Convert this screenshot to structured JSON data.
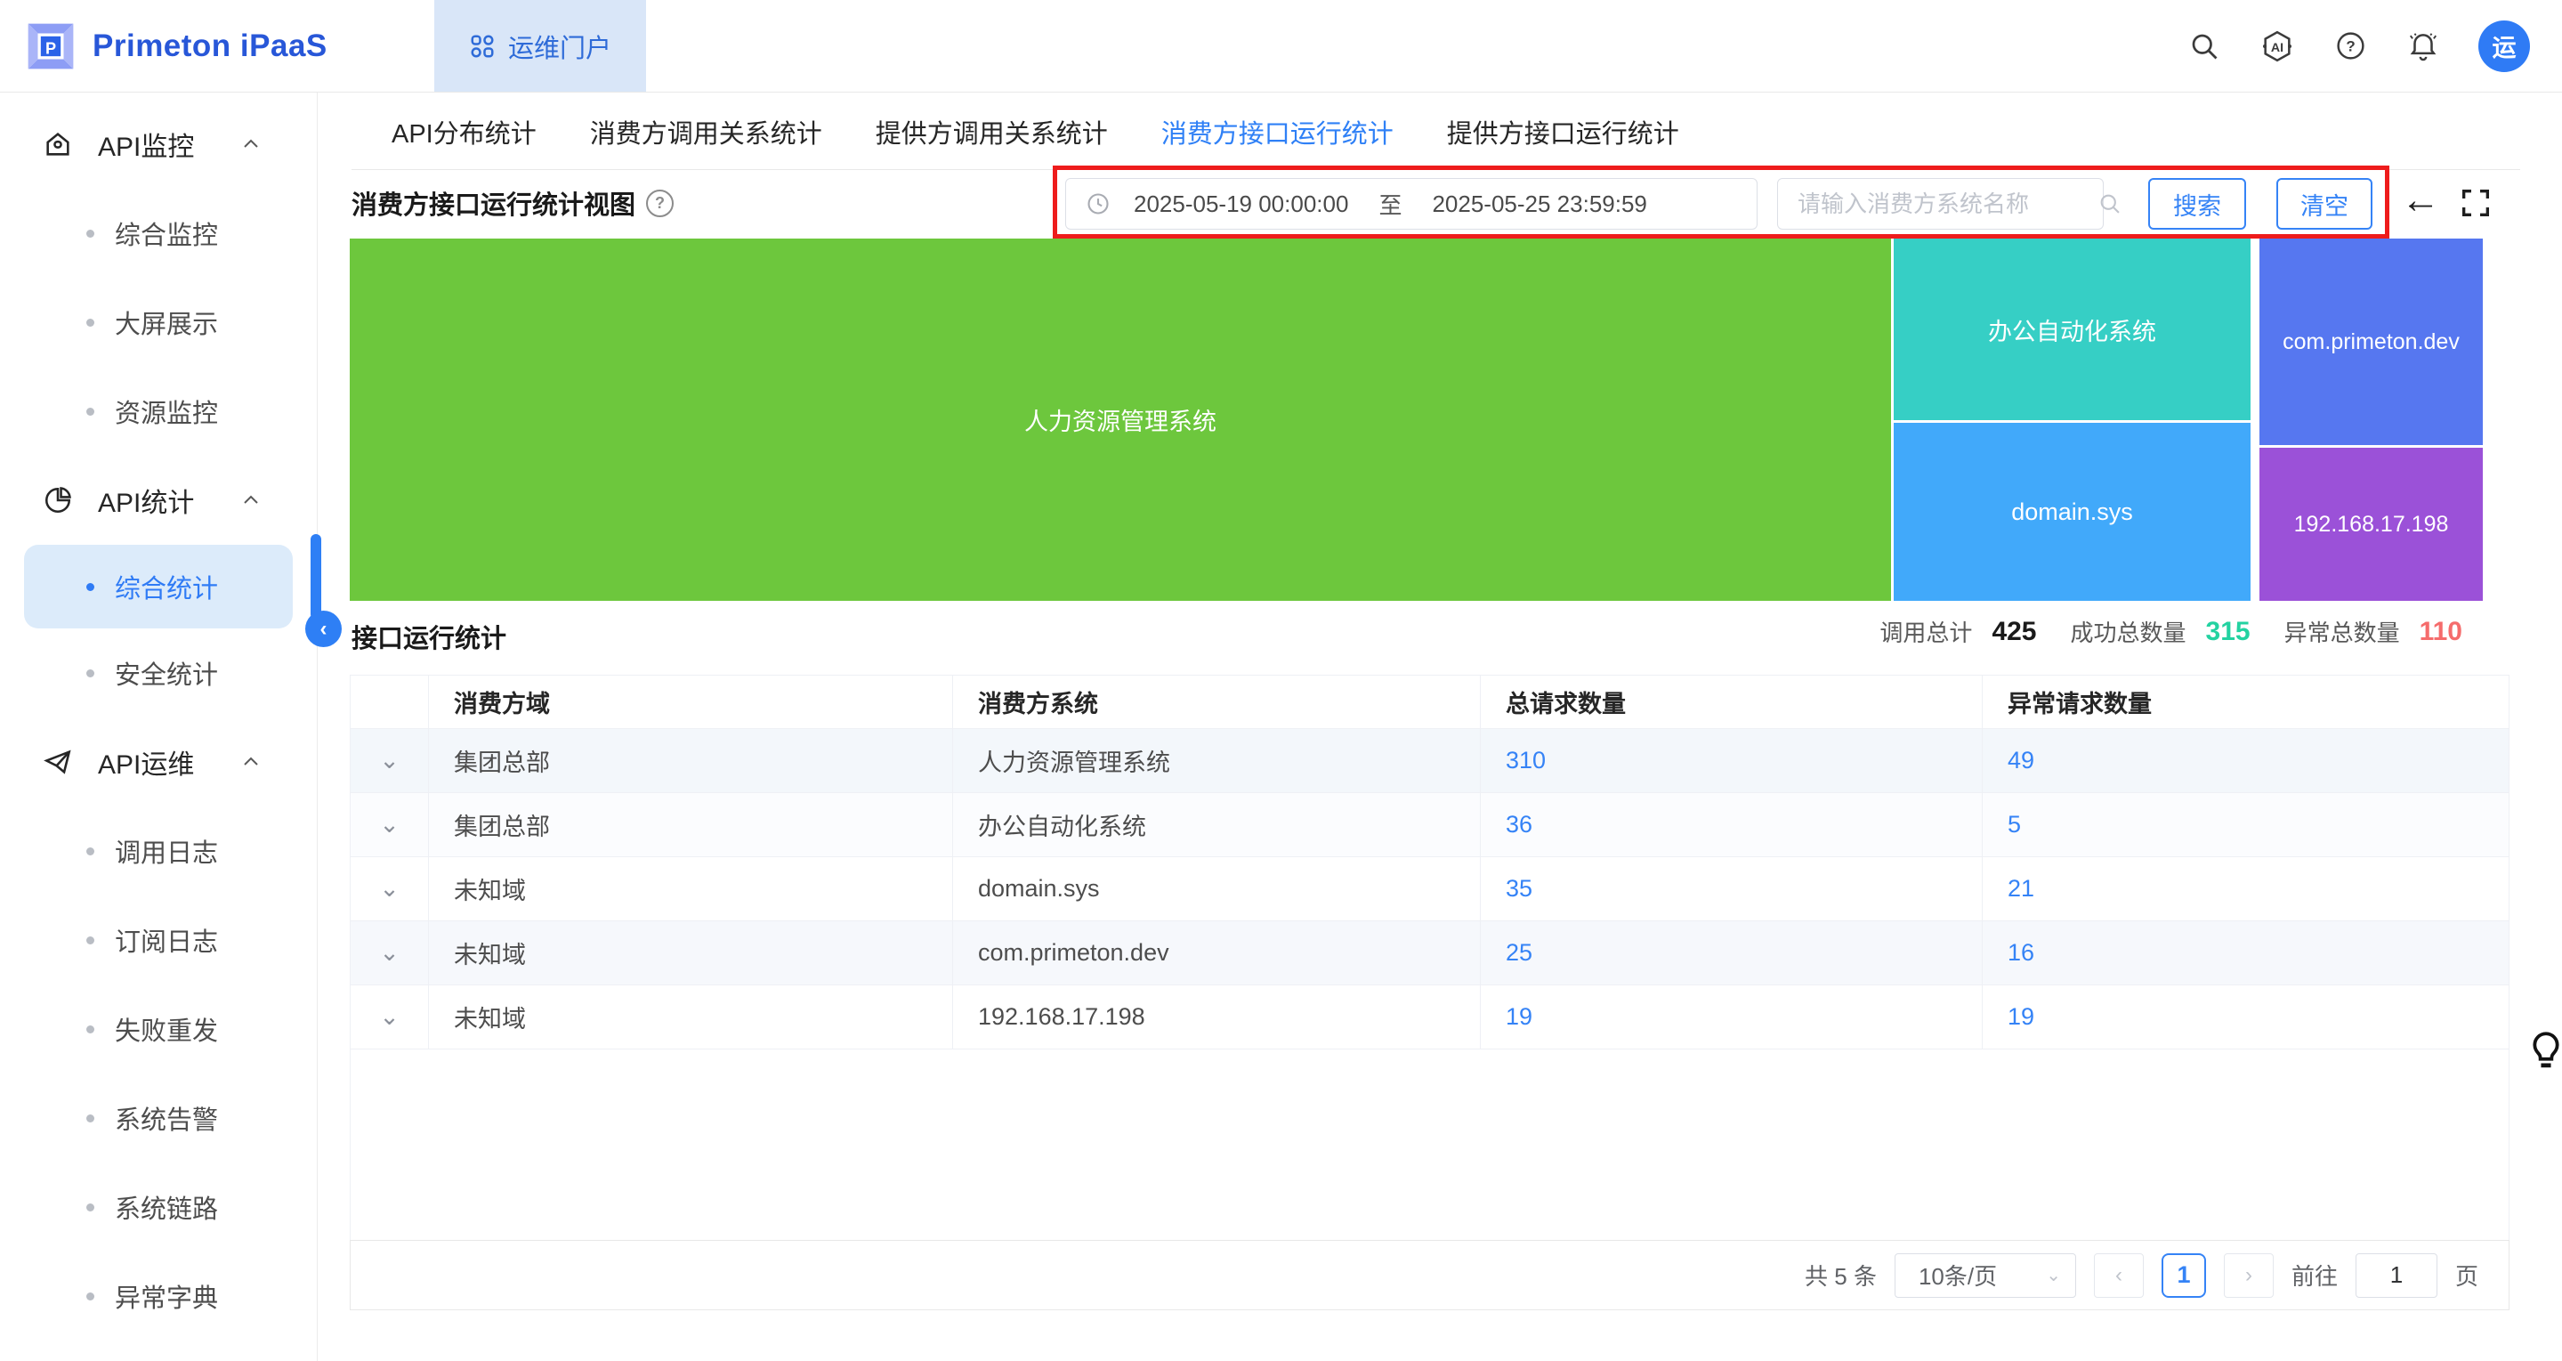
{
  "colors": {
    "primary": "#3583f6",
    "brand": "#2857d8",
    "portal_bg": "#d9e6f8",
    "success": "#23d2a1",
    "danger": "#f56c6c",
    "annotation": "#ee1c1c"
  },
  "header": {
    "brand": "Primeton iPaaS",
    "portal_tab": "运维门户",
    "avatar_text": "运"
  },
  "sidebar": {
    "groups": [
      {
        "label": "API监控",
        "items": [
          "综合监控",
          "大屏展示",
          "资源监控"
        ]
      },
      {
        "label": "API统计",
        "items": [
          "综合统计",
          "安全统计"
        ],
        "active": "综合统计"
      },
      {
        "label": "API运维",
        "items": [
          "调用日志",
          "订阅日志",
          "失败重发",
          "系统告警",
          "系统链路",
          "异常字典"
        ]
      }
    ]
  },
  "tabs": {
    "items": [
      "API分布统计",
      "消费方调用关系统计",
      "提供方调用关系统计",
      "消费方接口运行统计",
      "提供方接口运行统计"
    ],
    "active": "消费方接口运行统计"
  },
  "view": {
    "title": "消费方接口运行统计视图"
  },
  "filters": {
    "date_start": "2025-05-19 00:00:00",
    "date_to_label": "至",
    "date_end": "2025-05-25 23:59:59",
    "search_placeholder": "请输入消费方系统名称",
    "search_button": "搜索",
    "clear_button": "清空"
  },
  "chart_data": {
    "type": "treemap",
    "title": "消费方接口运行统计视图",
    "items": [
      {
        "name": "人力资源管理系统",
        "value": 310,
        "color": "#6dc73d"
      },
      {
        "name": "办公自动化系统",
        "value": 36,
        "color": "#36cfc5"
      },
      {
        "name": "domain.sys",
        "value": 35,
        "color": "#41a9fa"
      },
      {
        "name": "com.primeton.dev",
        "value": 25,
        "color": "#5677f0"
      },
      {
        "name": "192.168.17.198",
        "value": 19,
        "color": "#9b51d8"
      }
    ]
  },
  "stats": {
    "section_title": "接口运行统计",
    "total_label": "调用总计",
    "total_value": "425",
    "success_label": "成功总数量",
    "success_value": "315",
    "error_label": "异常总数量",
    "error_value": "110"
  },
  "table": {
    "headers": [
      "消费方域",
      "消费方系统",
      "总请求数量",
      "异常请求数量"
    ],
    "rows": [
      {
        "domain": "集团总部",
        "system": "人力资源管理系统",
        "total": "310",
        "errors": "49"
      },
      {
        "domain": "集团总部",
        "system": "办公自动化系统",
        "total": "36",
        "errors": "5"
      },
      {
        "domain": "未知域",
        "system": "domain.sys",
        "total": "35",
        "errors": "21"
      },
      {
        "domain": "未知域",
        "system": "com.primeton.dev",
        "total": "25",
        "errors": "16"
      },
      {
        "domain": "未知域",
        "system": "192.168.17.198",
        "total": "19",
        "errors": "19"
      }
    ]
  },
  "pagination": {
    "total_text": "共 5 条",
    "page_size": "10条/页",
    "current_page": "1",
    "goto_label": "前往",
    "goto_value": "1",
    "page_unit": "页"
  }
}
